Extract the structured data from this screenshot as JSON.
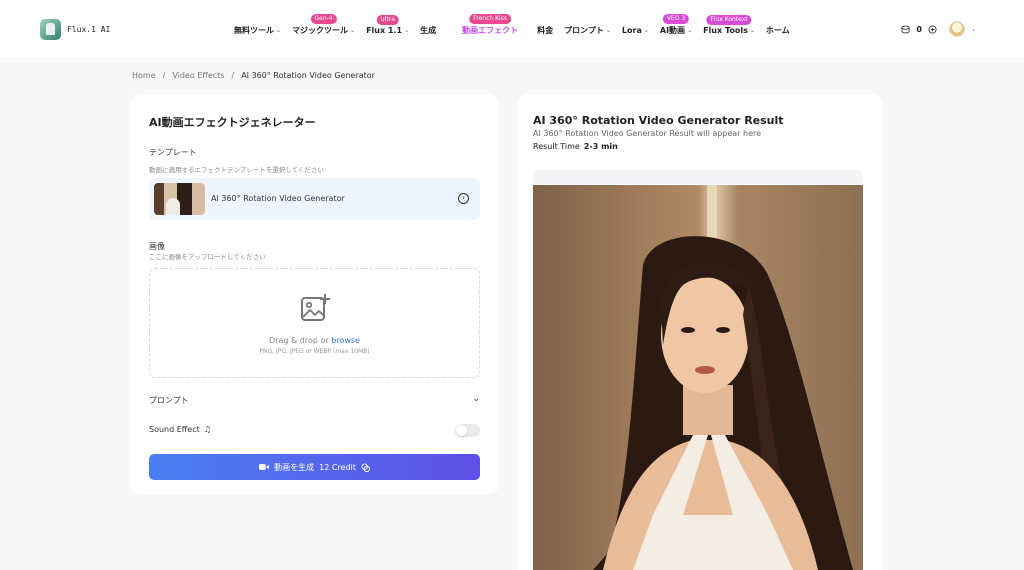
{
  "header": {
    "logo_text": "Flux.1 AI",
    "nav": [
      {
        "label": "無料ツール",
        "chevron": true,
        "badge": "",
        "badge_color": ""
      },
      {
        "label": "マジックツール",
        "chevron": true,
        "badge": "Gen-4",
        "badge_color": "#e8488f"
      },
      {
        "label": "Flux 1.1",
        "chevron": true,
        "badge": "Ultra",
        "badge_color": "#e8488f"
      },
      {
        "label": "生成",
        "chevron": false,
        "badge": "",
        "badge_color": ""
      },
      {
        "label": "動画エフェクト",
        "chevron": false,
        "badge": "French Kiss",
        "badge_color": "#e8488f",
        "active": true
      },
      {
        "label": "料金",
        "chevron": false,
        "badge": "",
        "badge_color": ""
      },
      {
        "label": "プロンプト",
        "chevron": true,
        "badge": "",
        "badge_color": ""
      },
      {
        "label": "Lora",
        "chevron": true,
        "badge": "",
        "badge_color": ""
      },
      {
        "label": "AI動画",
        "chevron": true,
        "badge": "VEO 3",
        "badge_color": "#d94bd6"
      },
      {
        "label": "Flux Tools",
        "chevron": true,
        "badge": "Flux Kontext",
        "badge_color": "#d94bd6"
      },
      {
        "label": "ホーム",
        "chevron": false,
        "badge": "",
        "badge_color": ""
      }
    ],
    "credits": "0",
    "coin_icon": "coin-stack-icon",
    "add_icon": "plus-circle-icon"
  },
  "breadcrumb": {
    "home": "Home",
    "section": "Video Effects",
    "current": "AI 360° Rotation Video Generator"
  },
  "form": {
    "title": "AI動画エフェクトジェネレーター",
    "template_label": "テンプレート",
    "template_help": "動画に適用するエフェクトテンプレートを選択してください",
    "template_name": "AI 360° Rotation Video Generator",
    "image_label": "画像",
    "image_help": "ここに画像をアップロードしてください",
    "upload_text": "Drag & drop or",
    "upload_browse": "browse",
    "upload_formats": "PNG, JPG, JPEG or WEBP (max 10MB)",
    "prompt_label": "プロンプト",
    "sound_label": "Sound Effect",
    "sound_on": false,
    "generate_label": "動画を生成",
    "generate_credit": "12 Credit"
  },
  "result": {
    "title": "AI 360° Rotation Video Generator Result",
    "subtitle": "AI 360° Rotation Video Generator Result will appear here",
    "time_label": "Result Time",
    "time_value": "2-3 min"
  },
  "colors": {
    "accent": "#4a7ff2",
    "accent2": "#5e50e6",
    "active_nav": "#c74be8",
    "badge_pink": "#e8488f"
  }
}
